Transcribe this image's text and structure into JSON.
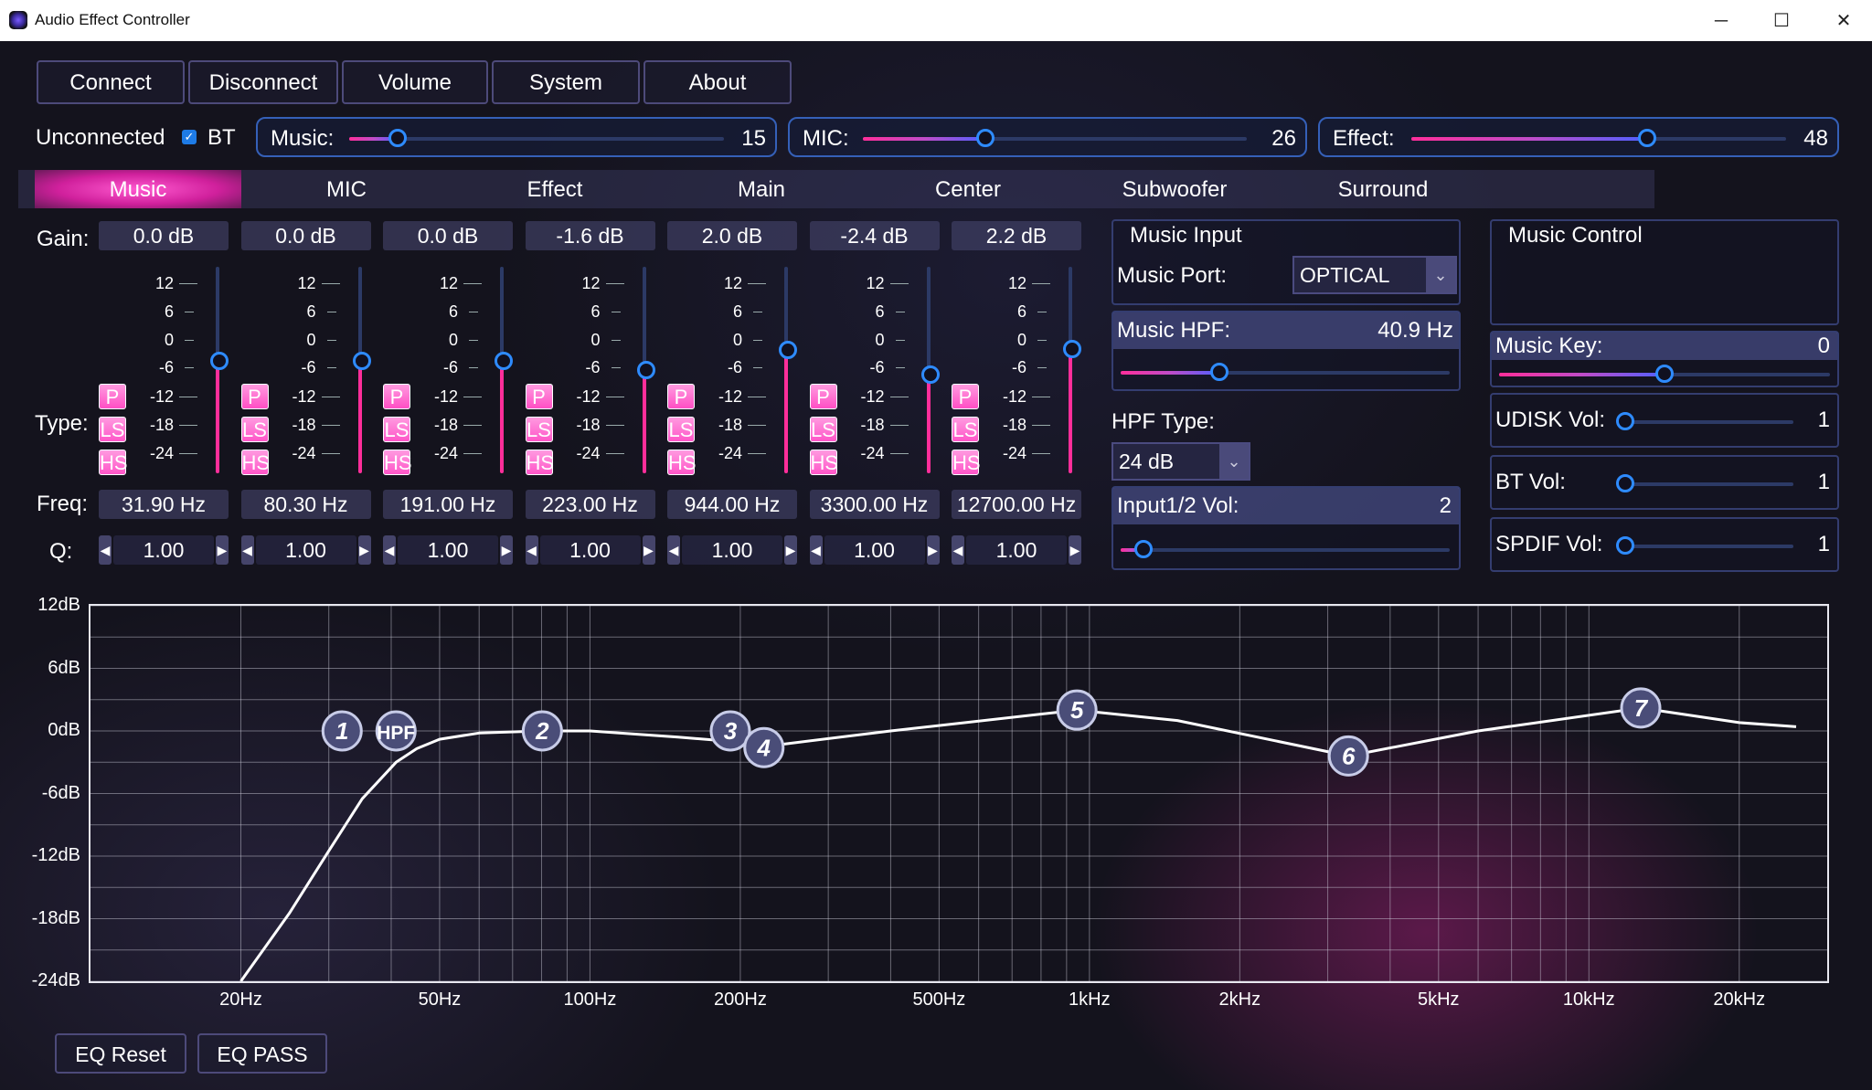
{
  "window": {
    "title": "Audio Effect Controller",
    "minimize_glyph": "─",
    "maximize_glyph": "☐",
    "close_glyph": "✕"
  },
  "toolbar": {
    "buttons": [
      "Connect",
      "Disconnect",
      "Volume",
      "System",
      "About"
    ]
  },
  "status": {
    "connection": "Unconnected",
    "bt_label": "BT",
    "bt_checked": true
  },
  "levels": [
    {
      "label": "Music:",
      "value": "15",
      "fraction": 0.13
    },
    {
      "label": "MIC:",
      "value": "26",
      "fraction": 0.32
    },
    {
      "label": "Effect:",
      "value": "48",
      "fraction": 0.63
    }
  ],
  "tabs": [
    "Music",
    "MIC",
    "Effect",
    "Main",
    "Center",
    "Subwoofer",
    "Surround"
  ],
  "active_tab": "Music",
  "eq": {
    "gain_label": "Gain:",
    "type_label": "Type:",
    "freq_label": "Freq:",
    "q_label": "Q:",
    "scale_ticks": [
      "12",
      "6",
      "0",
      "-6",
      "-12",
      "-18",
      "-24"
    ],
    "types": [
      "P",
      "LS",
      "HS"
    ],
    "bands": [
      {
        "gain": "0.0 dB",
        "gain_db": 0.0,
        "freq": "31.90 Hz",
        "q": "1.00"
      },
      {
        "gain": "0.0 dB",
        "gain_db": 0.0,
        "freq": "80.30 Hz",
        "q": "1.00"
      },
      {
        "gain": "0.0 dB",
        "gain_db": 0.0,
        "freq": "191.00 Hz",
        "q": "1.00"
      },
      {
        "gain": "-1.6 dB",
        "gain_db": -1.6,
        "freq": "223.00 Hz",
        "q": "1.00"
      },
      {
        "gain": "2.0 dB",
        "gain_db": 2.0,
        "freq": "944.00 Hz",
        "q": "1.00"
      },
      {
        "gain": "-2.4 dB",
        "gain_db": -2.4,
        "freq": "3300.00 Hz",
        "q": "1.00"
      },
      {
        "gain": "2.2 dB",
        "gain_db": 2.2,
        "freq": "12700.00 Hz",
        "q": "1.00"
      }
    ]
  },
  "music_input": {
    "title": "Music Input",
    "port_label": "Music Port:",
    "port_value": "OPTICAL",
    "hpf_label": "Music HPF:",
    "hpf_value": "40.9 Hz",
    "hpf_fraction": 0.3,
    "hpf_type_label": "HPF Type:",
    "hpf_type_value": "24 dB",
    "input_vol_label": "Input1/2 Vol:",
    "input_vol_value": "2",
    "input_vol_fraction": 0.07
  },
  "music_control": {
    "title": "Music Control",
    "key_label": "Music Key:",
    "key_value": "0",
    "key_fraction": 0.5,
    "rows": [
      {
        "label": "UDISK Vol:",
        "value": "1",
        "fraction": 0.04
      },
      {
        "label": "BT Vol:",
        "value": "1",
        "fraction": 0.04
      },
      {
        "label": "SPDIF Vol:",
        "value": "1",
        "fraction": 0.04
      }
    ]
  },
  "graph": {
    "y_labels": [
      "12dB",
      "6dB",
      "0dB",
      "-6dB",
      "-12dB",
      "-18dB",
      "-24dB"
    ],
    "x_labels": [
      "20Hz",
      "50Hz",
      "100Hz",
      "200Hz",
      "500Hz",
      "1kHz",
      "2kHz",
      "5kHz",
      "10kHz",
      "20kHz"
    ],
    "hpf_marker": "HPF",
    "markers": [
      "1",
      "2",
      "3",
      "4",
      "5",
      "6",
      "7"
    ]
  },
  "chart_data": {
    "type": "line",
    "title": "",
    "xlabel": "",
    "ylabel": "",
    "xscale": "log",
    "xlim": [
      10,
      30000
    ],
    "ylim": [
      -24,
      12
    ],
    "x_ticks": [
      "20Hz",
      "50Hz",
      "100Hz",
      "200Hz",
      "500Hz",
      "1kHz",
      "2kHz",
      "5kHz",
      "10kHz",
      "20kHz"
    ],
    "y_ticks": [
      "12dB",
      "6dB",
      "0dB",
      "-6dB",
      "-12dB",
      "-18dB",
      "-24dB"
    ],
    "grid": true,
    "series": [
      {
        "x": [
          20,
          25,
          30,
          35,
          40.9,
          45,
          50,
          60,
          80,
          100,
          150,
          191,
          223,
          400,
          944,
          1500,
          3300,
          6000,
          12700,
          20000,
          26000
        ],
        "y": [
          -24,
          -17.5,
          -11.5,
          -6.5,
          -3,
          -1.7,
          -0.8,
          -0.2,
          0,
          0,
          -0.6,
          -1.0,
          -1.5,
          0,
          2.0,
          1.0,
          -2.4,
          0,
          2.2,
          0.8,
          0.4
        ]
      }
    ],
    "points": [
      {
        "label": "1",
        "x": 31.9,
        "y": 0
      },
      {
        "label": "HPF",
        "x": 40.9,
        "y": 0
      },
      {
        "label": "2",
        "x": 80.3,
        "y": 0
      },
      {
        "label": "3",
        "x": 191,
        "y": 0
      },
      {
        "label": "4",
        "x": 223,
        "y": -1.6
      },
      {
        "label": "5",
        "x": 944,
        "y": 2.0
      },
      {
        "label": "6",
        "x": 3300,
        "y": -2.4
      },
      {
        "label": "7",
        "x": 12700,
        "y": 2.2
      }
    ]
  },
  "footer": {
    "buttons": [
      "EQ Reset",
      "EQ PASS"
    ]
  },
  "colors": {
    "accent_pink": "#ff2e9a",
    "accent_blue": "#2e8bff",
    "panel_border": "#343d70"
  }
}
